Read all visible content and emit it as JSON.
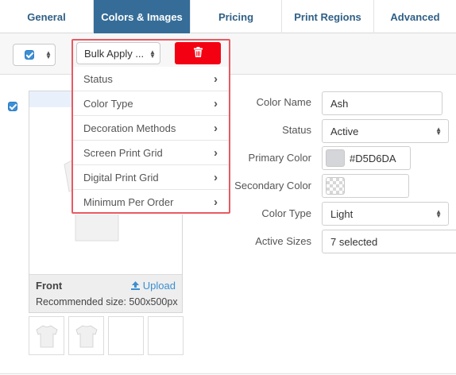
{
  "tabs": [
    {
      "label": "General",
      "active": false
    },
    {
      "label": "Colors & Images",
      "active": true
    },
    {
      "label": "Pricing",
      "active": false
    },
    {
      "label": "Print Regions",
      "active": false
    },
    {
      "label": "Advanced",
      "active": false
    }
  ],
  "toolbar": {
    "bulk_apply_label": "Bulk Apply ...",
    "delete_icon": "trash-icon",
    "select_all_checked": true
  },
  "bulk_menu": {
    "items": [
      {
        "label": "Status"
      },
      {
        "label": "Color Type"
      },
      {
        "label": "Decoration Methods"
      },
      {
        "label": "Screen Print Grid"
      },
      {
        "label": "Digital Print Grid"
      },
      {
        "label": "Minimum Per Order"
      }
    ]
  },
  "image": {
    "side_label": "Front",
    "upload_label": "Upload",
    "recommended": "Recommended size: 500x500px",
    "thumb_count": 4
  },
  "form": {
    "color_name_label": "Color Name",
    "color_name_value": "Ash",
    "status_label": "Status",
    "status_value": "Active",
    "primary_color_label": "Primary Color",
    "primary_color_value": "#D5D6DA",
    "secondary_color_label": "Secondary Color",
    "secondary_color_value": "",
    "color_type_label": "Color Type",
    "color_type_value": "Light",
    "active_sizes_label": "Active Sizes",
    "active_sizes_value": "7 selected"
  },
  "colors": {
    "tab_active": "#356D98",
    "delete": "#F30012",
    "highlight_outline": "#E85A63",
    "link": "#3A8FD0",
    "primary_swatch": "#D5D6DA"
  }
}
